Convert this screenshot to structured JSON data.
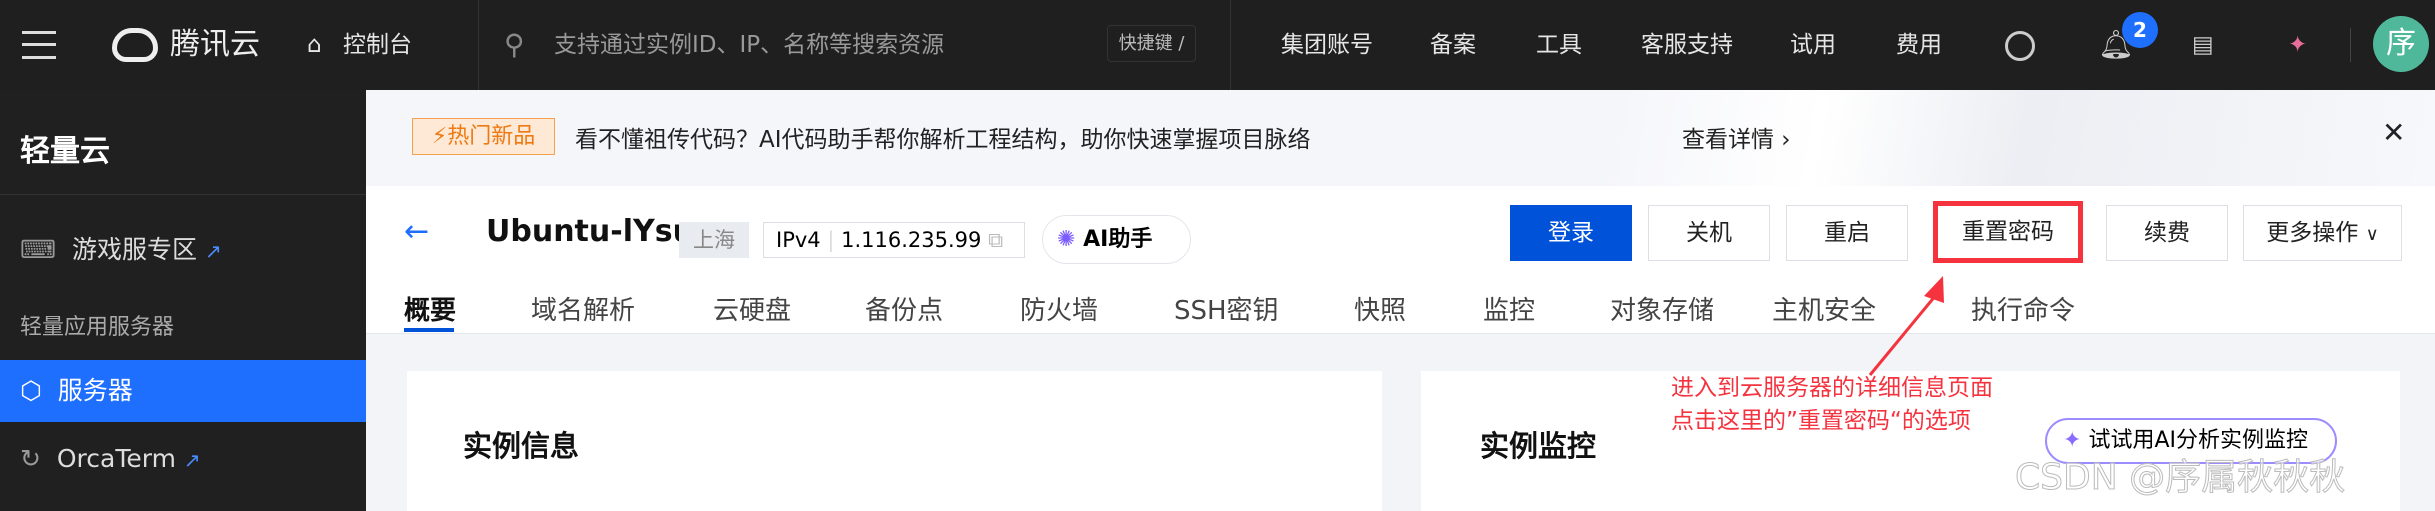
{
  "topbar": {
    "brand": "腾讯云",
    "console": "控制台",
    "search_placeholder": "支持通过实例ID、IP、名称等搜索资源",
    "shortcut": "快捷键 /",
    "nav": [
      "集团账号",
      "备案",
      "工具",
      "客服支持",
      "试用",
      "费用"
    ],
    "notification_count": "2",
    "avatar": "序"
  },
  "sidebar": {
    "title": "轻量云",
    "items": [
      {
        "label": "游戏服专区"
      },
      {
        "label": "轻量应用服务器"
      },
      {
        "label": "服务器"
      },
      {
        "label": "OrcaTerm"
      }
    ]
  },
  "banner": {
    "badge": "热门新品",
    "text": "看不懂祖传代码？AI代码助手帮你解析工程结构，助你快速掌握项目脉络",
    "link": "查看详情 ›"
  },
  "instance": {
    "name": "Ubuntu-lYsu",
    "region": "上海",
    "ip_label": "IPv4",
    "ip": "1.116.235.99",
    "ai": "AI助手"
  },
  "actions": [
    "登录",
    "关机",
    "重启",
    "重置密码",
    "续费",
    "更多操作"
  ],
  "tabs": [
    "概要",
    "域名解析",
    "云硬盘",
    "备份点",
    "防火墙",
    "SSH密钥",
    "快照",
    "监控",
    "对象存储",
    "主机安全",
    "执行命令"
  ],
  "cards": {
    "left_title": "实例信息",
    "right_title": "实例监控",
    "ai_monitor": "试试用AI分析实例监控"
  },
  "annotation": {
    "line1": "进入到云服务器的详细信息页面",
    "line2": "点击这里的”重置密码“的选项"
  },
  "watermark": "CSDN @序属秋秋秋",
  "colors": {
    "primary": "#0052d9",
    "annotation": "#f5333f"
  }
}
